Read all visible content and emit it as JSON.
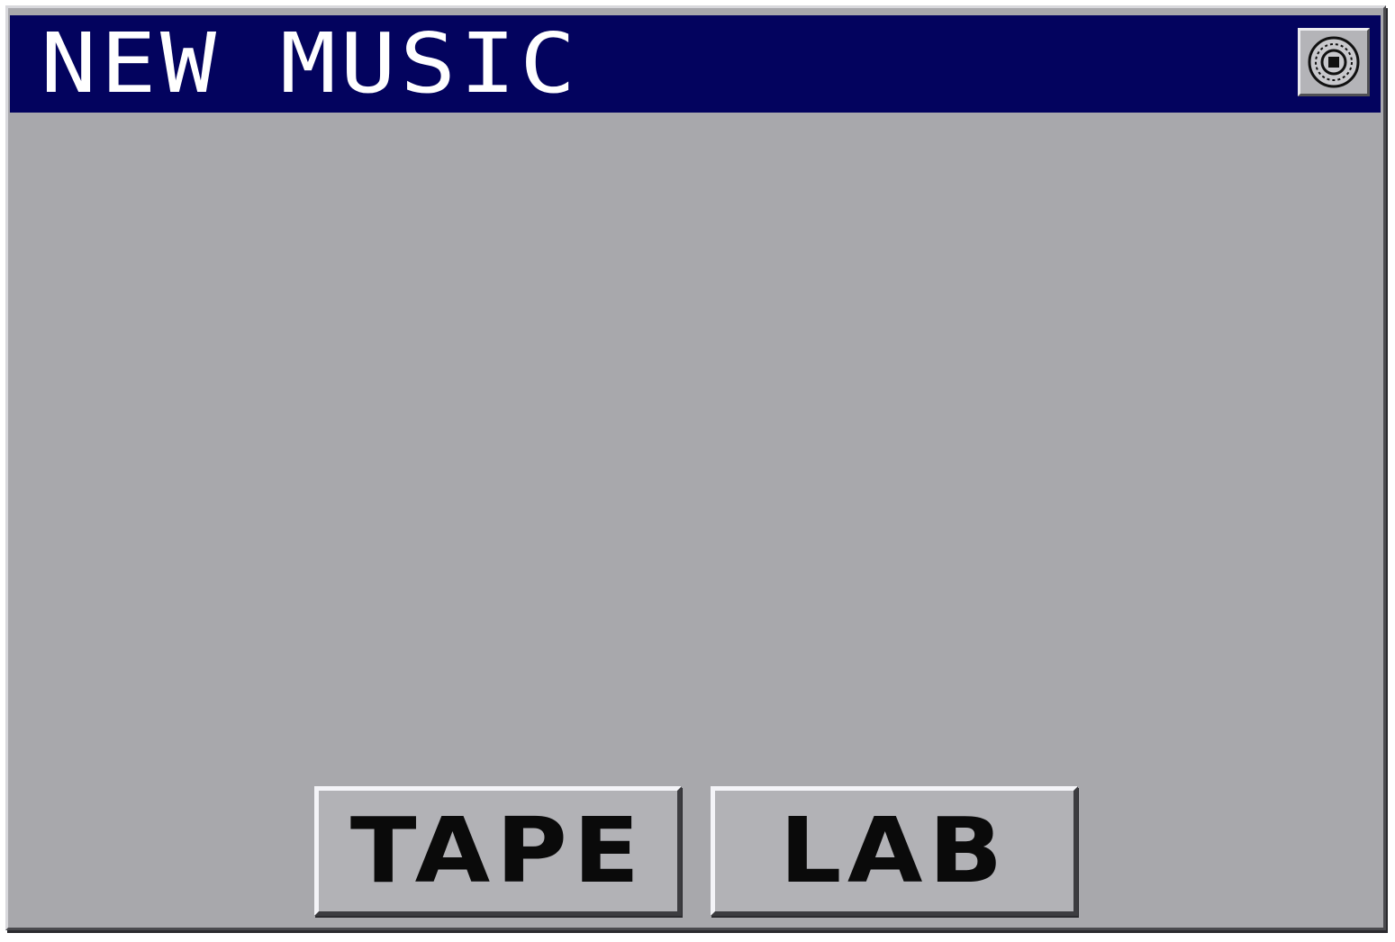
{
  "window": {
    "title": "NEW MUSIC",
    "close_icon": "cd-disc-icon"
  },
  "buttons": {
    "tape_label": "TAPE",
    "lab_label": "LAB"
  },
  "colors": {
    "titlebar": "#03035e",
    "window_bg": "#a8a8ac",
    "button_bg": "#b2b2b6",
    "title_text": "#ffffff",
    "button_text": "#0a0a0a"
  }
}
